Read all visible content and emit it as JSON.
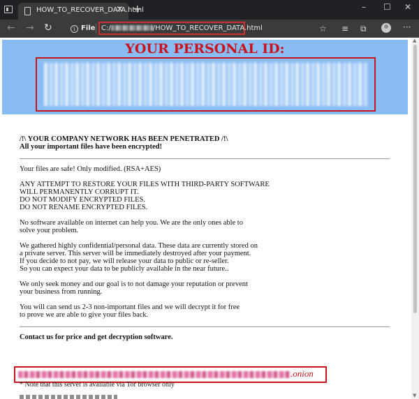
{
  "browser": {
    "tab_title": "HOW_TO_RECOVER_DATA.html",
    "file_label": "File",
    "url_prefix": "C:/",
    "url_suffix": "/HOW_TO_RECOVER_DATA.html"
  },
  "note": {
    "banner_title": "YOUR PERSONAL ID:",
    "headline_1": "/!\\ YOUR COMPANY NETWORK HAS BEEN PENETRATED /!\\",
    "headline_2": "All your important files have been encrypted!",
    "p1": "Your files are safe! Only modified. (RSA+AES)",
    "p2": "ANY ATTEMPT TO RESTORE YOUR FILES WITH THIRD-PARTY SOFTWARE\nWILL PERMANENTLY CORRUPT IT.\nDO NOT MODIFY ENCRYPTED FILES.\nDO NOT RENAME ENCRYPTED FILES.",
    "p3": "No software available on internet can help you. We are the only ones able to\nsolve your problem.",
    "p4": "We gathered highly confidential/personal data. These data are currently stored on\na private server. This server will be immediately destroyed after your payment.\nIf you decide to not pay, we will release your data to public or re-seller.\nSo you can expect your data to be publicly available in the near future..",
    "p5": "We only seek money and our goal is to not damage your reputation or prevent\nyour business from running.",
    "p6": "You will can send us 2-3 non-important files and we will decrypt it for free\nto prove we are able to give your files back.",
    "contact": "Contact us for price and get decryption software.",
    "onion_suffix": ".onion",
    "tor_note": "* Note that this server is available via Tor browser only"
  },
  "icons": {
    "back": "back-arrow-icon",
    "forward": "forward-arrow-icon",
    "refresh": "refresh-icon",
    "info": "info-icon",
    "favorites": "favorites-star-icon",
    "collections": "collections-icon",
    "extensions": "extensions-icon",
    "profile": "profile-avatar-icon",
    "more": "more-icon"
  },
  "colors": {
    "banner_bg": "#89bcf3",
    "alert_red": "#c8141c",
    "chrome_dark": "#202124"
  }
}
